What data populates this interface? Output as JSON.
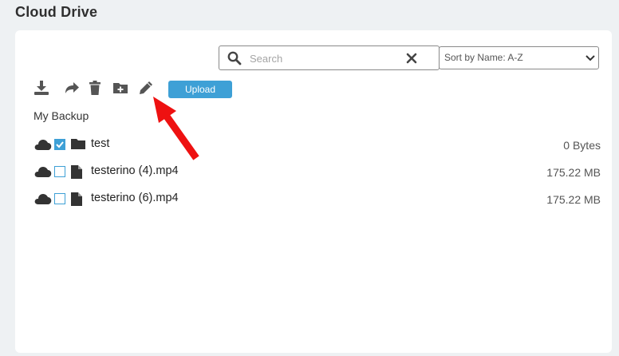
{
  "page": {
    "title": "Cloud Drive"
  },
  "search": {
    "placeholder": "Search",
    "value": ""
  },
  "sort": {
    "selected": "Sort by Name: A-Z"
  },
  "toolbar": {
    "download_icon": "download-icon",
    "share_icon": "share-icon",
    "delete_icon": "trash-icon",
    "new_folder_icon": "folder-plus-icon",
    "rename_icon": "pencil-icon",
    "upload_label": "Upload"
  },
  "breadcrumb": {
    "current": "My Backup"
  },
  "files": [
    {
      "name": "test",
      "type": "folder",
      "size": "0 Bytes",
      "checked": true
    },
    {
      "name": "testerino (4).mp4",
      "type": "file",
      "size": "175.22 MB",
      "checked": false
    },
    {
      "name": "testerino (6).mp4",
      "type": "file",
      "size": "175.22 MB",
      "checked": false
    }
  ],
  "annotation": {
    "type": "red-arrow-pointing-to-rename-icon",
    "color": "#ee1111"
  },
  "colors": {
    "accent": "#3ea0d6",
    "icon": "#555555",
    "background": "#eef1f3"
  }
}
